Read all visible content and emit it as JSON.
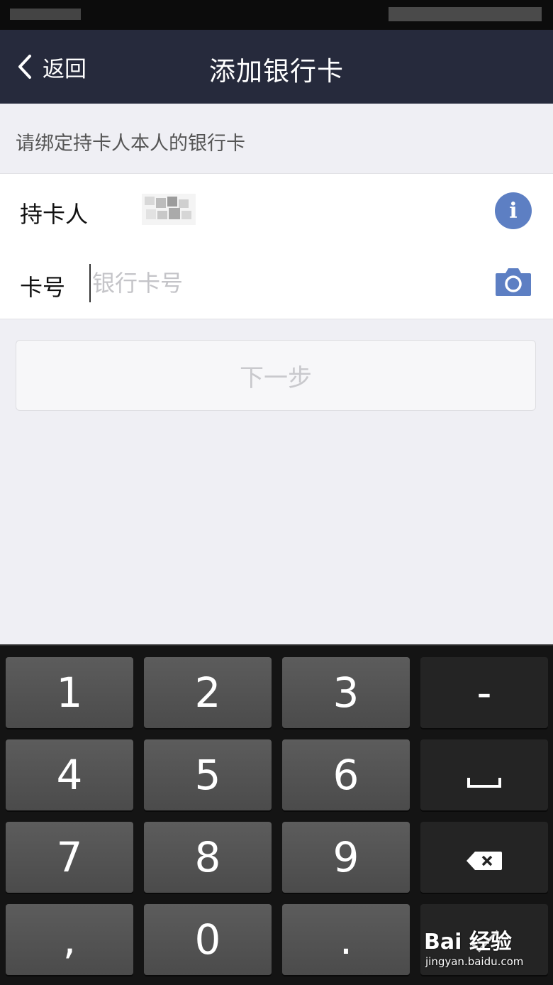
{
  "nav": {
    "back_label": "返回",
    "title": "添加银行卡"
  },
  "hint": "请绑定持卡人本人的银行卡",
  "form": {
    "holder_label": "持卡人",
    "card_label": "卡号",
    "card_placeholder": "银行卡号",
    "card_value": ""
  },
  "next_button": "下一步",
  "icons": {
    "info": "info-icon",
    "camera": "camera-icon",
    "back": "chevron-left-icon",
    "backspace": "backspace-icon",
    "space": "space-icon"
  },
  "colors": {
    "nav_bg": "#262a3c",
    "accent": "#5d7fc3",
    "page_bg": "#efeff4"
  },
  "keyboard": {
    "keys": [
      "1",
      "2",
      "3",
      "-",
      "4",
      "5",
      "6",
      "␣",
      "7",
      "8",
      "9",
      "⌫",
      ",",
      "0",
      ".",
      "✓"
    ]
  },
  "watermark": {
    "logo": "Bai 经验",
    "url": "jingyan.baidu.com"
  }
}
